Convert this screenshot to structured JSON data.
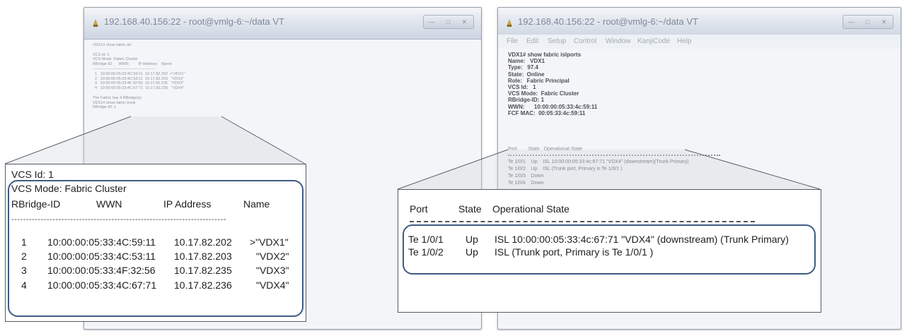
{
  "left_window": {
    "title": "192.168.40.156:22 - root@vmlg-6:~/data VT",
    "terminal_lines": "VDX1# show fabric all\n\nVCS Id: 1\nVCS Mode: Fabric Cluster\nRBridge-ID      WWN         IP Address    Name\n------------------------------------------------\n  1   10:00:00:05:33:4C:59:11  10.17.82.202  >\"VDX1\"\n  2   10:00:00:05:33:4C:53:11  10.17.82.203   \"VDX2\"\n  3   10:00:00:05:33:4F:32:56  10.17.82.235   \"VDX3\"\n  4   10:00:00:05:33:4C:67:71  10.17.82.236   \"VDX4\"\n\nThe Fabric has 4 RBridge(s)\nVDX1# show fabric trunk\nRBridge-ID: 1",
    "zoom": {
      "vcs_id": "VCS Id: 1",
      "vcs_mode": "VCS Mode: Fabric Cluster",
      "headers": [
        "RBridge-ID",
        "WWN",
        "IP Address",
        "Name"
      ],
      "separator": "-------------------------------------------------------------------------",
      "rows": [
        {
          "id": "1",
          "wwn": "10:00:00:05:33:4C:59:11",
          "ip": "10.17.82.202",
          "name": ">\"VDX1\""
        },
        {
          "id": "2",
          "wwn": "10:00:00:05:33:4C:53:11",
          "ip": "10.17.82.203",
          "name": "\"VDX2\""
        },
        {
          "id": "3",
          "wwn": "10:00:00:05:33:4F:32:56",
          "ip": "10.17.82.235",
          "name": "\"VDX3\""
        },
        {
          "id": "4",
          "wwn": "10:00:00:05:33:4C:67:71",
          "ip": "10.17.82.236",
          "name": "\"VDX4\""
        }
      ]
    }
  },
  "right_window": {
    "title": "192.168.40.156:22 - root@vmlg-6:~/data VT",
    "menu": [
      "File",
      "Edit",
      "Setup",
      "Control",
      "Window",
      "KanjiCode",
      "Help"
    ],
    "terminal_lines": "VDX1# show fabric islports\nName:   VDX1\nType:   97.4\nState:  Online\nRole:   Fabric Principal\nVCS Id:   1\nVCS Mode:  Fabric Cluster\nRBridge-ID: 1\nWWN:      10:00:00:05:33:4c:59:11\nFCF MAC:  00:05:33:4c:59:11",
    "port_header": "Port        State   Operational State",
    "port_lines": "Te 1/0/1    Up    ISL 10:00:00:05:33:4c:67:71 \"VDX4\" (downstream)(Trunk Primary)\nTe 1/0/2    Up    ISL (Trunk port, Primary is Te 1/0/1 )\nTe 1/0/3    Down\nTe 1/0/4    Down",
    "zoom": {
      "headers": [
        "Port",
        "State",
        "Operational State"
      ],
      "rows": [
        {
          "port": "Te 1/0/1",
          "state": "Up",
          "op": "ISL 10:00:00:05:33:4c:67:71 \"VDX4\" (downstream) (Trunk Primary)"
        },
        {
          "port": "Te 1/0/2",
          "state": "Up",
          "op": "ISL (Trunk port, Primary is Te 1/0/1 )"
        }
      ]
    }
  },
  "colors": {
    "frame": "#3e5c82",
    "titlebar": "#d6dde7"
  }
}
